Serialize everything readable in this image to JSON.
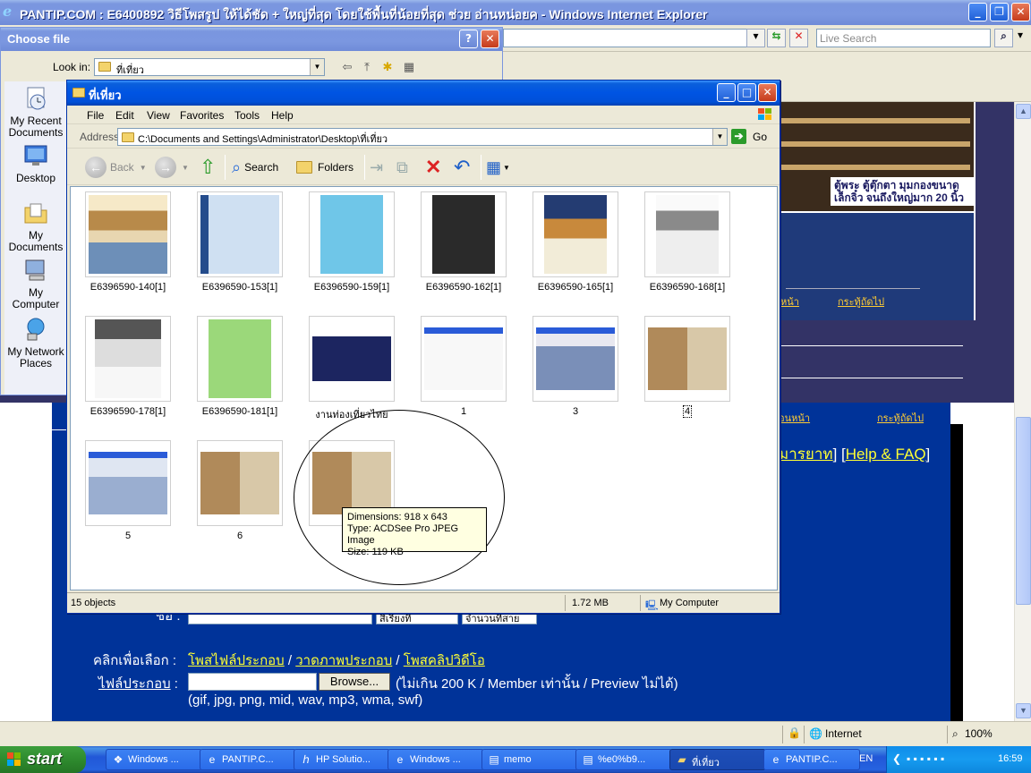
{
  "ie": {
    "title": "PANTIP.COM : E6400892 วิธีโพสรูป ให้ได้ชัด + ใหญ่ที่สุด โดยใช้พื้นที่น้อยที่สุด ช่วย อ่านหน่อยค",
    "title_suffix": " - Windows Internet Explorer",
    "search_placeholder": "Live Search",
    "status": {
      "zone": "Internet",
      "zoom": "100%"
    }
  },
  "page": {
    "banner_text": "ตู้พระ ตู้ตุ๊กตา มุมกองขนาดเล็กจิ๋ว จนถึงใหญ่มาก 20 นิ้ว",
    "nav_link_left": "หน้า",
    "nav_link_right": "กระทู้ถัดไป",
    "nav_link_left2": "อนหน้า",
    "nav_link_right2": "กระทู้ถัดไป",
    "help_prefix": "มารยาท",
    "help_link": "Help & FAQ",
    "select_a": "สีเรียงที",
    "select_b": "จำนวนที่สาย",
    "click_label": "คลิกเพื่อเลือก :",
    "link_attach": "โพสไฟล์ประกอบ",
    "link_draw": "วาดภาพประกอบ",
    "link_clip": "โพสคลิปวิดีโอ",
    "file_label": "ไฟล์ประกอบ",
    "browse": "Browse...",
    "limit_note": "(ไม่เกิน 200 K / Member เท่านั้น / Preview ไม่ได้)",
    "types_note": "(gif, jpg, png, mid, wav, mp3, wma, swf)",
    "row_label": "ชื่อ :"
  },
  "choose_file": {
    "title": "Choose file",
    "look_in_label": "Look in:",
    "look_in_value": "ที่เที่ยว",
    "places": [
      "My Recent Documents",
      "Desktop",
      "My Documents",
      "My Computer",
      "My Network Places"
    ]
  },
  "explorer": {
    "title": "ที่เที่ยว",
    "menu": [
      "File",
      "Edit",
      "View",
      "Favorites",
      "Tools",
      "Help"
    ],
    "address_label": "Address",
    "address_value": "C:\\Documents and Settings\\Administrator\\Desktop\\ที่เที่ยว",
    "go_label": "Go",
    "toolbar": {
      "back": "Back",
      "search": "Search",
      "folders": "Folders"
    },
    "files": [
      "E6396590-140[1]",
      "E6396590-153[1]",
      "E6396590-159[1]",
      "E6396590-162[1]",
      "E6396590-165[1]",
      "E6396590-168[1]",
      "E6396590-178[1]",
      "E6396590-181[1]",
      "งานท่องเที่ยวไทย",
      "1",
      "3",
      "4",
      "5",
      "6",
      ""
    ],
    "tooltip": {
      "dimensions": "Dimensions: 918 x 643",
      "type": "Type: ACDSee Pro JPEG Image",
      "size": "Size: 119 KB"
    },
    "status": {
      "objects": "15 objects",
      "size": "1.72 MB",
      "location": "My Computer"
    }
  },
  "taskbar": {
    "start": "start",
    "tasks": [
      "Windows ...",
      "PANTIP.C...",
      "HP Solutio...",
      "Windows ...",
      "memo",
      "%e0%b9...",
      "ที่เที่ยว",
      "PANTIP.C..."
    ],
    "active_index": 6,
    "lang": "EN",
    "clock": "16:59"
  }
}
